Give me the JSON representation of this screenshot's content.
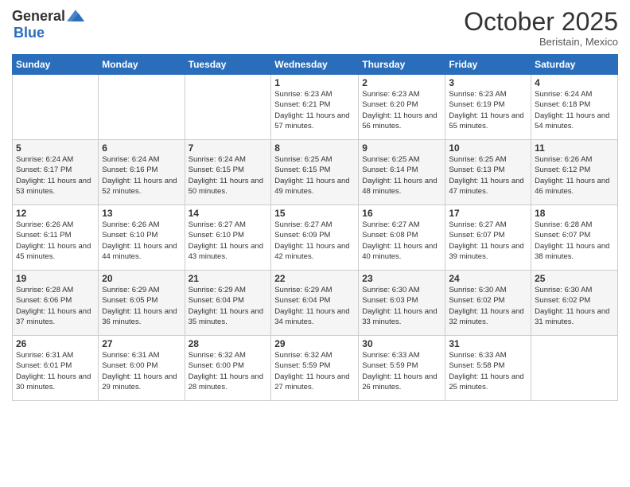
{
  "logo": {
    "general": "General",
    "blue": "Blue"
  },
  "header": {
    "month": "October 2025",
    "location": "Beristain, Mexico"
  },
  "days_of_week": [
    "Sunday",
    "Monday",
    "Tuesday",
    "Wednesday",
    "Thursday",
    "Friday",
    "Saturday"
  ],
  "weeks": [
    [
      {
        "day": "",
        "info": ""
      },
      {
        "day": "",
        "info": ""
      },
      {
        "day": "",
        "info": ""
      },
      {
        "day": "1",
        "info": "Sunrise: 6:23 AM\nSunset: 6:21 PM\nDaylight: 11 hours and 57 minutes."
      },
      {
        "day": "2",
        "info": "Sunrise: 6:23 AM\nSunset: 6:20 PM\nDaylight: 11 hours and 56 minutes."
      },
      {
        "day": "3",
        "info": "Sunrise: 6:23 AM\nSunset: 6:19 PM\nDaylight: 11 hours and 55 minutes."
      },
      {
        "day": "4",
        "info": "Sunrise: 6:24 AM\nSunset: 6:18 PM\nDaylight: 11 hours and 54 minutes."
      }
    ],
    [
      {
        "day": "5",
        "info": "Sunrise: 6:24 AM\nSunset: 6:17 PM\nDaylight: 11 hours and 53 minutes."
      },
      {
        "day": "6",
        "info": "Sunrise: 6:24 AM\nSunset: 6:16 PM\nDaylight: 11 hours and 52 minutes."
      },
      {
        "day": "7",
        "info": "Sunrise: 6:24 AM\nSunset: 6:15 PM\nDaylight: 11 hours and 50 minutes."
      },
      {
        "day": "8",
        "info": "Sunrise: 6:25 AM\nSunset: 6:15 PM\nDaylight: 11 hours and 49 minutes."
      },
      {
        "day": "9",
        "info": "Sunrise: 6:25 AM\nSunset: 6:14 PM\nDaylight: 11 hours and 48 minutes."
      },
      {
        "day": "10",
        "info": "Sunrise: 6:25 AM\nSunset: 6:13 PM\nDaylight: 11 hours and 47 minutes."
      },
      {
        "day": "11",
        "info": "Sunrise: 6:26 AM\nSunset: 6:12 PM\nDaylight: 11 hours and 46 minutes."
      }
    ],
    [
      {
        "day": "12",
        "info": "Sunrise: 6:26 AM\nSunset: 6:11 PM\nDaylight: 11 hours and 45 minutes."
      },
      {
        "day": "13",
        "info": "Sunrise: 6:26 AM\nSunset: 6:10 PM\nDaylight: 11 hours and 44 minutes."
      },
      {
        "day": "14",
        "info": "Sunrise: 6:27 AM\nSunset: 6:10 PM\nDaylight: 11 hours and 43 minutes."
      },
      {
        "day": "15",
        "info": "Sunrise: 6:27 AM\nSunset: 6:09 PM\nDaylight: 11 hours and 42 minutes."
      },
      {
        "day": "16",
        "info": "Sunrise: 6:27 AM\nSunset: 6:08 PM\nDaylight: 11 hours and 40 minutes."
      },
      {
        "day": "17",
        "info": "Sunrise: 6:27 AM\nSunset: 6:07 PM\nDaylight: 11 hours and 39 minutes."
      },
      {
        "day": "18",
        "info": "Sunrise: 6:28 AM\nSunset: 6:07 PM\nDaylight: 11 hours and 38 minutes."
      }
    ],
    [
      {
        "day": "19",
        "info": "Sunrise: 6:28 AM\nSunset: 6:06 PM\nDaylight: 11 hours and 37 minutes."
      },
      {
        "day": "20",
        "info": "Sunrise: 6:29 AM\nSunset: 6:05 PM\nDaylight: 11 hours and 36 minutes."
      },
      {
        "day": "21",
        "info": "Sunrise: 6:29 AM\nSunset: 6:04 PM\nDaylight: 11 hours and 35 minutes."
      },
      {
        "day": "22",
        "info": "Sunrise: 6:29 AM\nSunset: 6:04 PM\nDaylight: 11 hours and 34 minutes."
      },
      {
        "day": "23",
        "info": "Sunrise: 6:30 AM\nSunset: 6:03 PM\nDaylight: 11 hours and 33 minutes."
      },
      {
        "day": "24",
        "info": "Sunrise: 6:30 AM\nSunset: 6:02 PM\nDaylight: 11 hours and 32 minutes."
      },
      {
        "day": "25",
        "info": "Sunrise: 6:30 AM\nSunset: 6:02 PM\nDaylight: 11 hours and 31 minutes."
      }
    ],
    [
      {
        "day": "26",
        "info": "Sunrise: 6:31 AM\nSunset: 6:01 PM\nDaylight: 11 hours and 30 minutes."
      },
      {
        "day": "27",
        "info": "Sunrise: 6:31 AM\nSunset: 6:00 PM\nDaylight: 11 hours and 29 minutes."
      },
      {
        "day": "28",
        "info": "Sunrise: 6:32 AM\nSunset: 6:00 PM\nDaylight: 11 hours and 28 minutes."
      },
      {
        "day": "29",
        "info": "Sunrise: 6:32 AM\nSunset: 5:59 PM\nDaylight: 11 hours and 27 minutes."
      },
      {
        "day": "30",
        "info": "Sunrise: 6:33 AM\nSunset: 5:59 PM\nDaylight: 11 hours and 26 minutes."
      },
      {
        "day": "31",
        "info": "Sunrise: 6:33 AM\nSunset: 5:58 PM\nDaylight: 11 hours and 25 minutes."
      },
      {
        "day": "",
        "info": ""
      }
    ]
  ]
}
